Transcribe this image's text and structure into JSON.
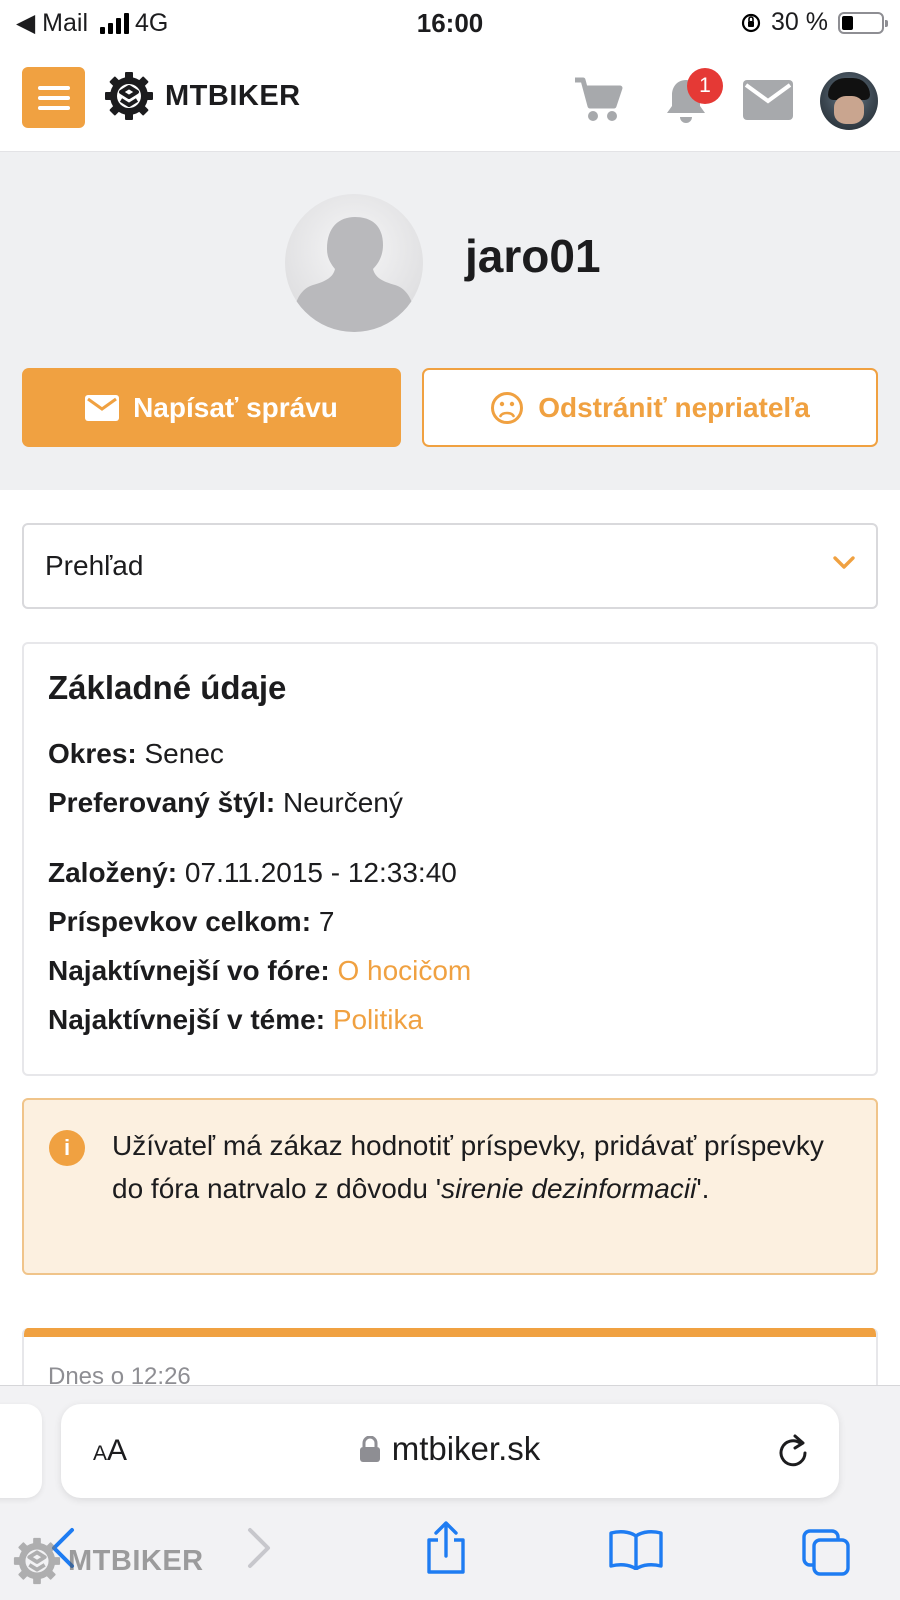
{
  "status_bar": {
    "back_app": "◀ Mail",
    "network": "4G",
    "time": "16:00",
    "battery_percent": "30 %",
    "battery_level": 0.3
  },
  "header": {
    "logo_text": "MTBIKER",
    "notification_count": "1",
    "icons": [
      "menu-icon",
      "cart-icon",
      "bell-icon",
      "mail-icon",
      "avatar"
    ]
  },
  "profile": {
    "username": "jaro01",
    "message_button": "Napísať správu",
    "unfriend_button": "Odstrániť nepriateľa"
  },
  "view_select": {
    "selected": "Prehľad"
  },
  "basic_info": {
    "title": "Základné údaje",
    "rows": [
      {
        "label": "Okres:",
        "value": "Senec"
      },
      {
        "label": "Preferovaný štýl:",
        "value": "Neurčený"
      },
      {
        "label": "Založený:",
        "value": "07.11.2015 - 12:33:40"
      },
      {
        "label": "Príspevkov celkom:",
        "value": "7"
      },
      {
        "label": "Najaktívnejší vo fóre:",
        "value": "O hocičom"
      },
      {
        "label": "Najaktívnejší v téme:",
        "value": "Politika"
      }
    ]
  },
  "alert": {
    "text_before": "Užívateľ má zákaz hodnotiť príspevky, pridávať príspevky do fóra natrvalo z dôvodu '",
    "reason": "sirenie dezinformacii",
    "text_after": "'."
  },
  "post": {
    "date": "Dnes o 12:26"
  },
  "browser": {
    "text_size_label_small": "A",
    "text_size_label_large": "A",
    "url": "mtbiker.sk"
  },
  "watermark": {
    "text": "MTBIKER"
  },
  "colors": {
    "accent": "#f0a141",
    "alert_bg": "#fcf0e0",
    "badge": "#e53935",
    "ios_blue": "#1e7cf2"
  }
}
